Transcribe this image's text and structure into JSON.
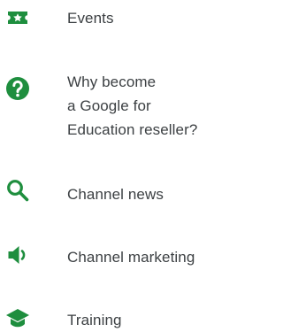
{
  "accent_color": "#1e8e3e",
  "text_color": "#3c4043",
  "nav": {
    "items": [
      {
        "label": "Events",
        "icon": "star-ticket-icon"
      },
      {
        "label": "Why become\na Google for\nEducation reseller?",
        "icon": "help-circle-icon"
      },
      {
        "label": "Channel news",
        "icon": "search-icon"
      },
      {
        "label": "Channel marketing",
        "icon": "volume-speaker-icon"
      },
      {
        "label": "Training",
        "icon": "graduation-cap-icon"
      }
    ]
  }
}
